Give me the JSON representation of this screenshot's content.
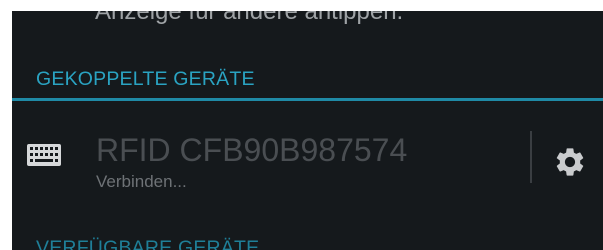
{
  "top_hint": "Anzeige für andere antippen.",
  "paired_section": {
    "header": "GEKOPPELTE GERÄTE",
    "devices": [
      {
        "icon": "keyboard-icon",
        "name": "RFID CFB90B987574",
        "status": "Verbinden...",
        "settings_icon": "gear-icon"
      }
    ]
  },
  "available_section": {
    "header": "VERFÜGBARE GERÄTE"
  },
  "colors": {
    "background": "#15191c",
    "accent": "#2aa3c2",
    "device_name": "#4a4e52",
    "device_status": "#6e7276"
  }
}
